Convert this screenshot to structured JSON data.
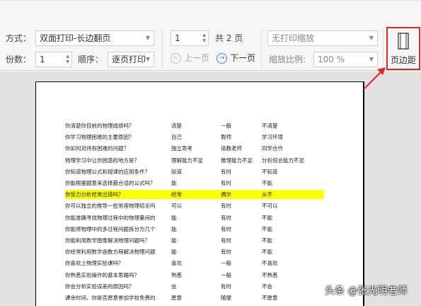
{
  "toolbar": {
    "mode_label": "方式：",
    "mode_value": "双面打印-长边翻页",
    "copies_label": "份数：",
    "copies_value": "1",
    "order_label": "顺序：",
    "order_value": "逐页打印",
    "page_value": "1",
    "page_total": "共 2 页",
    "prev_label": "上一页",
    "next_label": "下一页",
    "zoom_mode_value": "无打印缩放",
    "zoom_ratio_label": "缩放比例:",
    "zoom_ratio_value": "100 %",
    "margin_label": "页边距",
    "colors": {
      "highlight_border": "#e32525",
      "accent": "#3d7fd6"
    }
  },
  "document": {
    "rows": [
      [
        "你清楚你目前的物理成绩吗？",
        "清楚",
        "一般",
        "不清楚"
      ],
      [
        "你学习物理困难的主要原因？",
        "自己",
        "教师",
        "学习环境"
      ],
      [
        "你如何对待有困难的问题？",
        "独立思考",
        "请教老师",
        "同学合作"
      ],
      [
        "物理学习中让你困惑的地方是？",
        "理解能力不足",
        "推理能力不足",
        "分析综合能力不足"
      ],
      [
        "你知道物理公式和规律的应用条件？",
        "知道",
        "有时",
        "不知道"
      ],
      [
        "你能根据题意来选择最合适的公式吗？",
        "能",
        "有时",
        "不能"
      ],
      [
        "你受力分析经常出错吗？",
        "经常",
        "偶尔",
        "从不"
      ],
      [
        "你可以独立的推导一些常用物理结论吗",
        "可以",
        "有时",
        "不可以"
      ],
      [
        "你能准确寻找物理过程中的物理量间的",
        "能",
        "有时",
        "不能"
      ],
      [
        "你能将物理中的多过程问题拆分为几个",
        "能",
        "有时",
        "不能"
      ],
      [
        "你能利用数学图像解决物理问题吗？",
        "能",
        "有时",
        "不能"
      ],
      [
        "你经常利用数学函数方程解决物理问题",
        "能",
        "有时",
        "不能"
      ],
      [
        "你喜欢上物理实验课吗？",
        "喜欢",
        "一般",
        "不喜欢"
      ],
      [
        "你熟悉实验操作的基本思路吗？",
        "熟悉",
        "一般",
        "不熟悉"
      ],
      [
        "你会分析实验误差的原因吗？",
        "会",
        "有时",
        "不会"
      ],
      [
        "课余时间，你是否愿意参加学校免费的",
        "愿意",
        "随便",
        "不愿意"
      ]
    ],
    "highlight_row": 6,
    "highlight_color": "#ffff00"
  },
  "watermark": "头条 @张光明老师"
}
